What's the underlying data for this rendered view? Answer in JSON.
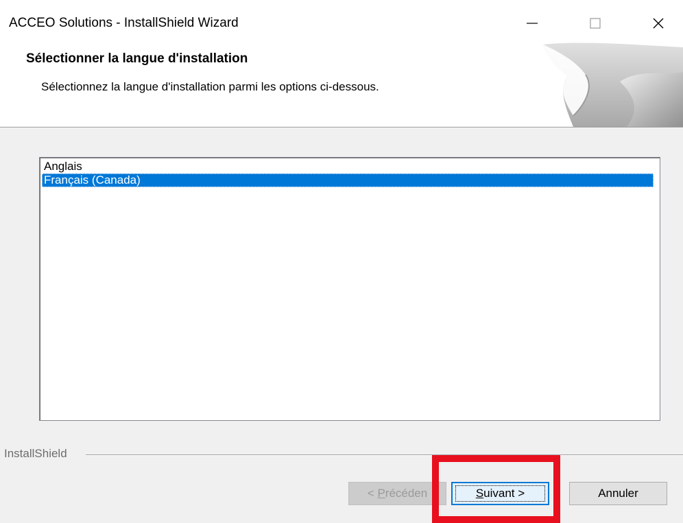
{
  "window": {
    "title": "ACCEO Solutions - InstallShield Wizard"
  },
  "header": {
    "title": "Sélectionner la langue d'installation",
    "subtitle": "Sélectionnez la langue d'installation parmi les options ci-dessous."
  },
  "languages": {
    "items": [
      "Anglais",
      "Français (Canada)"
    ],
    "selected": "Français (Canada)"
  },
  "footer": {
    "brand": "InstallShield",
    "back_label_prefix": "< ",
    "back_label_mnemonic": "P",
    "back_label_rest": "récéden",
    "next_label_mnemonic": "S",
    "next_label_rest": "uivant >",
    "cancel_label": "Annuler"
  },
  "colors": {
    "selection": "#0078d7",
    "highlight_box": "#e8101e",
    "dialog_bg": "#f0f0f0"
  },
  "icons": [
    "minimize-icon",
    "maximize-icon",
    "close-icon"
  ]
}
